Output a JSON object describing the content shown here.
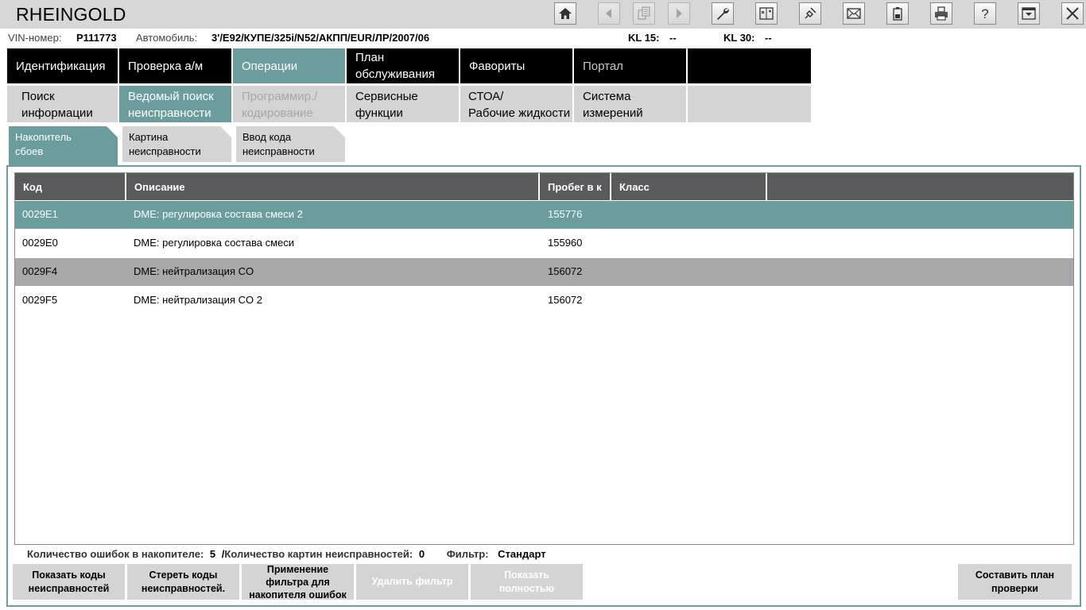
{
  "app": {
    "title": "RHEINGOLD"
  },
  "toolbar": {
    "buttons": [
      {
        "name": "home-button",
        "icon": "home-icon",
        "enabled": true
      },
      {
        "name": "back-button",
        "icon": "chevron-left-icon",
        "enabled": false
      },
      {
        "name": "copy-button",
        "icon": "documents-icon",
        "enabled": false
      },
      {
        "name": "forward-button",
        "icon": "chevron-right-icon",
        "enabled": false
      },
      {
        "name": "workshop-button",
        "icon": "wrench-icon",
        "enabled": true
      },
      {
        "name": "diagnostics-button",
        "icon": "scanner-icon",
        "enabled": true
      },
      {
        "name": "connection-button",
        "icon": "plug-icon",
        "enabled": true
      },
      {
        "name": "mail-button",
        "icon": "envelope-icon",
        "enabled": true
      },
      {
        "name": "battery-button",
        "icon": "battery-icon",
        "enabled": true
      },
      {
        "name": "print-button",
        "icon": "printer-icon",
        "enabled": true
      },
      {
        "name": "help-button",
        "icon": "question-icon",
        "enabled": true
      },
      {
        "name": "minimize-button",
        "icon": "window-down-icon",
        "enabled": true
      },
      {
        "name": "close-button",
        "icon": "close-icon",
        "enabled": true
      }
    ]
  },
  "vehicle": {
    "vin_label": "VIN-номер:",
    "vin": "P111773",
    "car_label": "Автомобиль:",
    "car": "3'/E92/КУПЕ/325i/N52/АКПП/EUR/ЛР/2007/06",
    "kl15_label": "KL 15:",
    "kl15": "--",
    "kl30_label": "KL 30:",
    "kl30": "--"
  },
  "nav": {
    "main": [
      {
        "label": "Идентификация",
        "state": "normal"
      },
      {
        "label": "Проверка а/м",
        "state": "normal"
      },
      {
        "label": "Операции",
        "state": "active"
      },
      {
        "label1": "План",
        "label2": "обслуживания",
        "state": "normal"
      },
      {
        "label": "Фавориты",
        "state": "normal"
      },
      {
        "label": "Портал",
        "state": "dim"
      },
      {
        "label": "",
        "state": "normal"
      }
    ],
    "sub": [
      {
        "label1": "Поиск",
        "label2": "информации",
        "state": "normal"
      },
      {
        "label1": "Ведомый поиск",
        "label2": "неисправности",
        "state": "active"
      },
      {
        "label1": "Программир./",
        "label2": "кодирование",
        "state": "disabled"
      },
      {
        "label1": "Сервисные",
        "label2": "функции",
        "state": "normal"
      },
      {
        "label1": "СТОА/",
        "label2": "Рабочие жидкости",
        "state": "normal"
      },
      {
        "label1": "Система",
        "label2": "измерений",
        "state": "normal"
      }
    ]
  },
  "tabs": [
    {
      "label1": "Накопитель",
      "label2": "сбоев",
      "active": true
    },
    {
      "label1": "Картина",
      "label2": "неисправности",
      "active": false
    },
    {
      "label1": "Ввод кода",
      "label2": "неисправности",
      "active": false
    }
  ],
  "table": {
    "headers": [
      "Код",
      "Описание",
      "Пробег в к",
      "Класс"
    ],
    "rows": [
      {
        "code": "0029E1",
        "desc": "DME: регулировка состава смеси 2",
        "mileage": "155776",
        "class": "",
        "style": "selected"
      },
      {
        "code": "0029E0",
        "desc": "DME: регулировка состава смеси",
        "mileage": "155960",
        "class": "",
        "style": "normal"
      },
      {
        "code": "0029F4",
        "desc": "DME: нейтрализация CO",
        "mileage": "156072",
        "class": "",
        "style": "alt"
      },
      {
        "code": "0029F5",
        "desc": "DME: нейтрализация CO 2",
        "mileage": "156072",
        "class": "",
        "style": "normal"
      }
    ]
  },
  "summary": {
    "errors_label": "Количество ошибок в накопителе:",
    "errors_count": "5",
    "separator": "/",
    "pictures_label": "Количество картин неисправностей:",
    "pictures_count": "0",
    "filter_label": "Фильтр:",
    "filter_value": "Стандарт"
  },
  "buttons": {
    "show_codes": {
      "line1": "Показать коды",
      "line2": "неисправностей"
    },
    "clear_codes": {
      "line1": "Стереть коды",
      "line2": "неисправностей."
    },
    "apply_filter": {
      "line1": "Применение",
      "line2": "фильтра для",
      "line3": "накопителя ошибок"
    },
    "delete_filter": "Удалить фильтр",
    "show_full": {
      "line1": "Показать",
      "line2": "полностью"
    },
    "make_plan": {
      "line1": "Составить план",
      "line2": "проверки"
    }
  },
  "colors": {
    "accent": "#6a9d9c",
    "nav_dark": "#000000",
    "nav_light": "#d4d4d4",
    "header_gray": "#5a5a5a",
    "alt_row": "#a8a8a8"
  }
}
